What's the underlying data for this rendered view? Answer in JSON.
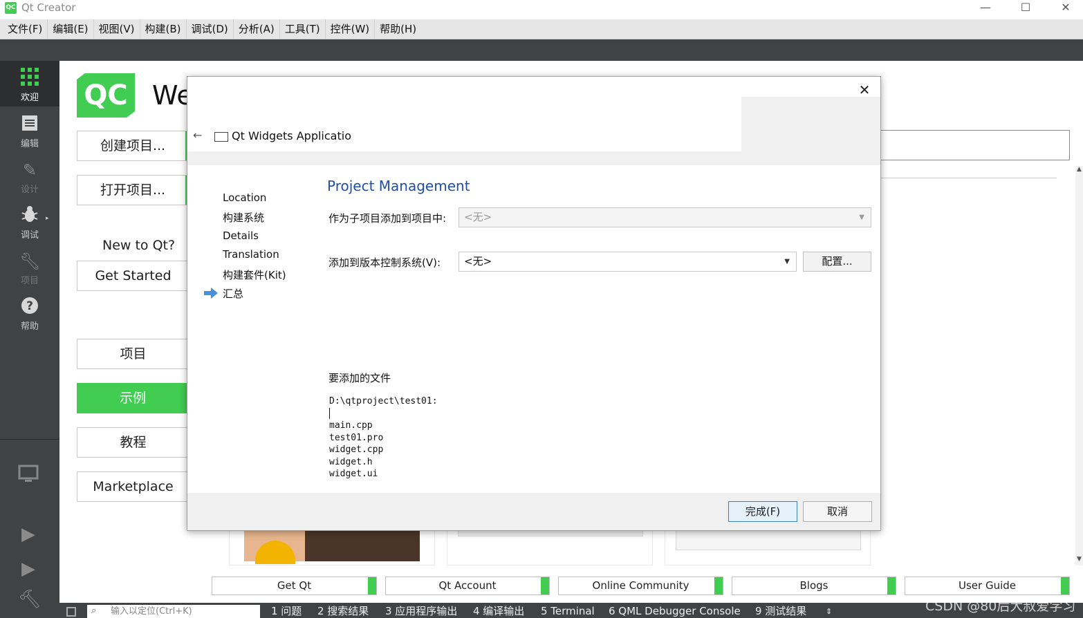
{
  "window": {
    "title": "Qt Creator",
    "logo_text": "QC",
    "minimize": "—",
    "maximize": "☐",
    "close": "✕"
  },
  "menu": [
    "文件(F)",
    "编辑(E)",
    "视图(V)",
    "构建(B)",
    "调试(D)",
    "分析(A)",
    "工具(T)",
    "控件(W)",
    "帮助(H)"
  ],
  "modes": [
    {
      "label": "欢迎",
      "icon": "grid-icon"
    },
    {
      "label": "编辑",
      "icon": "edit-icon"
    },
    {
      "label": "设计",
      "icon": "pencil-icon"
    },
    {
      "label": "调试",
      "icon": "bug-icon"
    },
    {
      "label": "项目",
      "icon": "wrench-icon"
    },
    {
      "label": "帮助",
      "icon": "help-icon"
    }
  ],
  "welcome": {
    "logo_text": "QC",
    "title": "We",
    "create_project": "创建项目...",
    "open_project": "打开项目...",
    "new_to_qt": "New to Qt?",
    "get_started": "Get Started",
    "projects": "项目",
    "examples": "示例",
    "tutorials": "教程",
    "marketplace": "Marketplace"
  },
  "bottom_links": [
    "Get Qt",
    "Qt Account",
    "Online Community",
    "Blogs",
    "User Guide"
  ],
  "status": {
    "locator_placeholder": "输入以定位(Ctrl+K)",
    "tabs": [
      "1  问题",
      "2  搜索结果",
      "3  应用程序输出",
      "4  编译输出",
      "5  Terminal",
      "6  QML Debugger Console",
      "9  测试结果"
    ],
    "watermark": "CSDN @80后大叔爱学习"
  },
  "dialog": {
    "close": "✕",
    "back": "←",
    "header": "Qt Widgets Applicatio",
    "steps": [
      "Location",
      "构建系统",
      "Details",
      "Translation",
      "构建套件(Kit)",
      "汇总"
    ],
    "active_step": "汇总",
    "section_title": "Project Management",
    "add_as_subproject_label": "作为子项目添加到项目中:",
    "add_as_subproject_value": "<无>",
    "vcs_label": "添加到版本控制系统(V):",
    "vcs_value": "<无>",
    "configure_button": "配置...",
    "files_label": "要添加的文件",
    "files_dir": "D:\\qtproject\\test01:",
    "files": [
      "main.cpp",
      "test01.pro",
      "widget.cpp",
      "widget.h",
      "widget.ui"
    ],
    "finish_button": "完成(F)",
    "cancel_button": "取消"
  },
  "colors": {
    "accent": "#41cd52",
    "sidebar": "#404244",
    "title_blue": "#1f4fa8"
  }
}
